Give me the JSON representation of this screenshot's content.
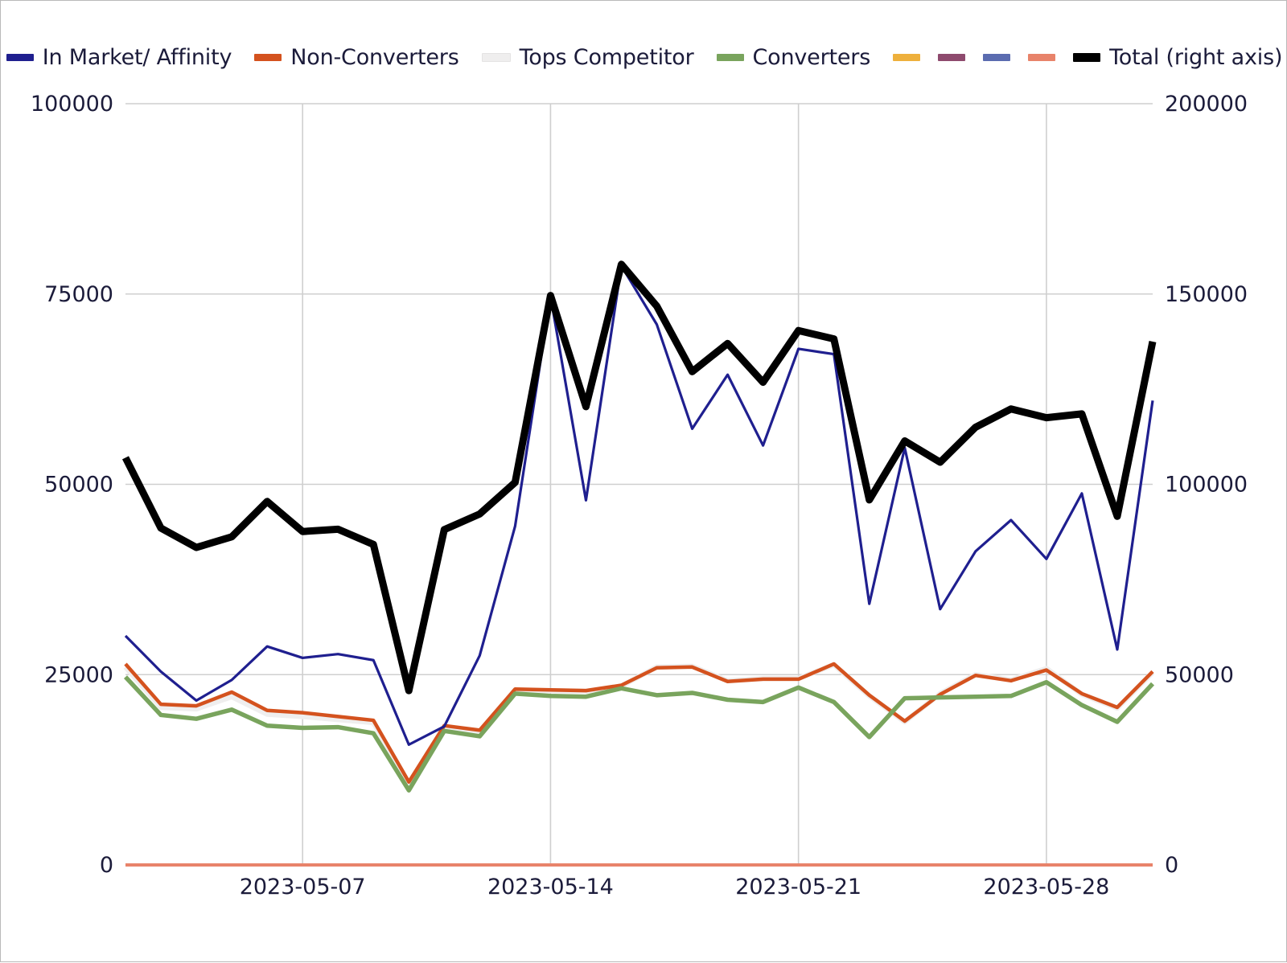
{
  "legend": {
    "items": [
      {
        "label": "In Market/ Affinity",
        "color": "#1f1f8f",
        "key": "in_market_affinity",
        "thick": false
      },
      {
        "label": "Non-Converters",
        "color": "#d4521e",
        "key": "non_converters",
        "thick": false
      },
      {
        "label": "Tops Competitor",
        "color": "#efeeee",
        "key": "tops_competitor",
        "thick": false
      },
      {
        "label": "Converters",
        "color": "#79a45d",
        "key": "converters",
        "thick": false
      },
      {
        "label": "",
        "color": "#eeb03c",
        "key": "series_5",
        "thick": false
      },
      {
        "label": "",
        "color": "#8e4a6e",
        "key": "series_6",
        "thick": false
      },
      {
        "label": "",
        "color": "#5b6cb0",
        "key": "series_7",
        "thick": false
      },
      {
        "label": "",
        "color": "#e8836a",
        "key": "series_8",
        "thick": false
      },
      {
        "label": "Total (right axis)",
        "color": "#000000",
        "key": "total",
        "thick": true
      }
    ]
  },
  "axes": {
    "left": {
      "ticks": [
        "0",
        "25000",
        "50000",
        "75000",
        "100000"
      ],
      "min": 0,
      "max": 100000
    },
    "right": {
      "ticks": [
        "0",
        "50000",
        "100000",
        "150000",
        "200000"
      ],
      "min": 0,
      "max": 200000
    },
    "x": {
      "ticks": [
        "2023-05-07",
        "2023-05-14",
        "2023-05-21",
        "2023-05-28"
      ],
      "tick_index": [
        5,
        12,
        19,
        26
      ]
    }
  },
  "chart_data": {
    "type": "line",
    "title": "",
    "xlabel": "",
    "ylabel": "",
    "ylim": [
      0,
      100000
    ],
    "y2lim": [
      0,
      200000
    ],
    "grid": true,
    "legend_position": "top",
    "x": [
      "2023-05-02",
      "2023-05-03",
      "2023-05-04",
      "2023-05-05",
      "2023-05-06",
      "2023-05-07",
      "2023-05-08",
      "2023-05-09",
      "2023-05-10",
      "2023-05-11",
      "2023-05-12",
      "2023-05-13",
      "2023-05-14",
      "2023-05-15",
      "2023-05-16",
      "2023-05-17",
      "2023-05-18",
      "2023-05-19",
      "2023-05-20",
      "2023-05-21",
      "2023-05-22",
      "2023-05-23",
      "2023-05-24",
      "2023-05-25",
      "2023-05-26",
      "2023-05-27",
      "2023-05-28",
      "2023-05-29",
      "2023-05-30",
      "2023-05-31"
    ],
    "series": [
      {
        "name": "In Market/ Affinity",
        "color": "#1f1f8f",
        "axis": "left",
        "width": 3.2,
        "values": [
          30100,
          25400,
          21600,
          24300,
          28700,
          27200,
          27700,
          26900,
          15800,
          18200,
          27500,
          44500,
          74700,
          47900,
          78700,
          71000,
          57300,
          64400,
          55100,
          67800,
          67100,
          34300,
          54800,
          33600,
          41200,
          45300,
          40200,
          48800,
          28300,
          61000
        ]
      },
      {
        "name": "Non-Converters",
        "color": "#d4521e",
        "axis": "left",
        "width": 4.5,
        "values": [
          26400,
          21100,
          20900,
          22700,
          20300,
          20000,
          19500,
          19000,
          10900,
          18300,
          17700,
          23100,
          23000,
          22900,
          23600,
          25900,
          26000,
          24100,
          24400,
          24400,
          26400,
          22300,
          18900,
          22400,
          24900,
          24200,
          25600,
          22500,
          20700,
          25400
        ]
      },
      {
        "name": "Tops Competitor",
        "color": "#efeeee",
        "axis": "left",
        "width": 6.5,
        "values": [
          26000,
          20700,
          20500,
          22100,
          19800,
          19500,
          19100,
          18700,
          10700,
          18000,
          17400,
          22900,
          22900,
          22800,
          23500,
          26000,
          26100,
          24200,
          24500,
          24500,
          26300,
          22200,
          18800,
          22500,
          25000,
          24300,
          25800,
          22400,
          20600,
          25300
        ]
      },
      {
        "name": "Converters",
        "color": "#79a45d",
        "axis": "left",
        "width": 5.5,
        "values": [
          24700,
          19700,
          19200,
          20400,
          18300,
          18000,
          18100,
          17300,
          9800,
          17600,
          16900,
          22500,
          22200,
          22100,
          23200,
          22300,
          22600,
          21700,
          21400,
          23300,
          21400,
          16800,
          21900,
          22000,
          22100,
          22200,
          24000,
          21000,
          18800,
          23800
        ]
      },
      {
        "name": "Total (right axis)",
        "color": "#000000",
        "axis": "right",
        "width": 9,
        "values": [
          107000,
          88500,
          83400,
          86200,
          95500,
          87600,
          88200,
          84200,
          45800,
          88100,
          92200,
          100500,
          149600,
          120400,
          157800,
          146800,
          129600,
          137000,
          126800,
          140400,
          138200,
          95900,
          111400,
          105800,
          115000,
          119800,
          117500,
          118500,
          91600,
          137500
        ]
      }
    ],
    "flat_zero_series": [
      {
        "name": "series_5",
        "color": "#eeb03c",
        "axis": "left",
        "value": 0
      },
      {
        "name": "series_6",
        "color": "#8e4a6e",
        "axis": "left",
        "value": 0
      },
      {
        "name": "series_7",
        "color": "#5b6cb0",
        "axis": "left",
        "value": 0
      },
      {
        "name": "series_8",
        "color": "#e8836a",
        "axis": "left",
        "value": 0
      }
    ]
  }
}
